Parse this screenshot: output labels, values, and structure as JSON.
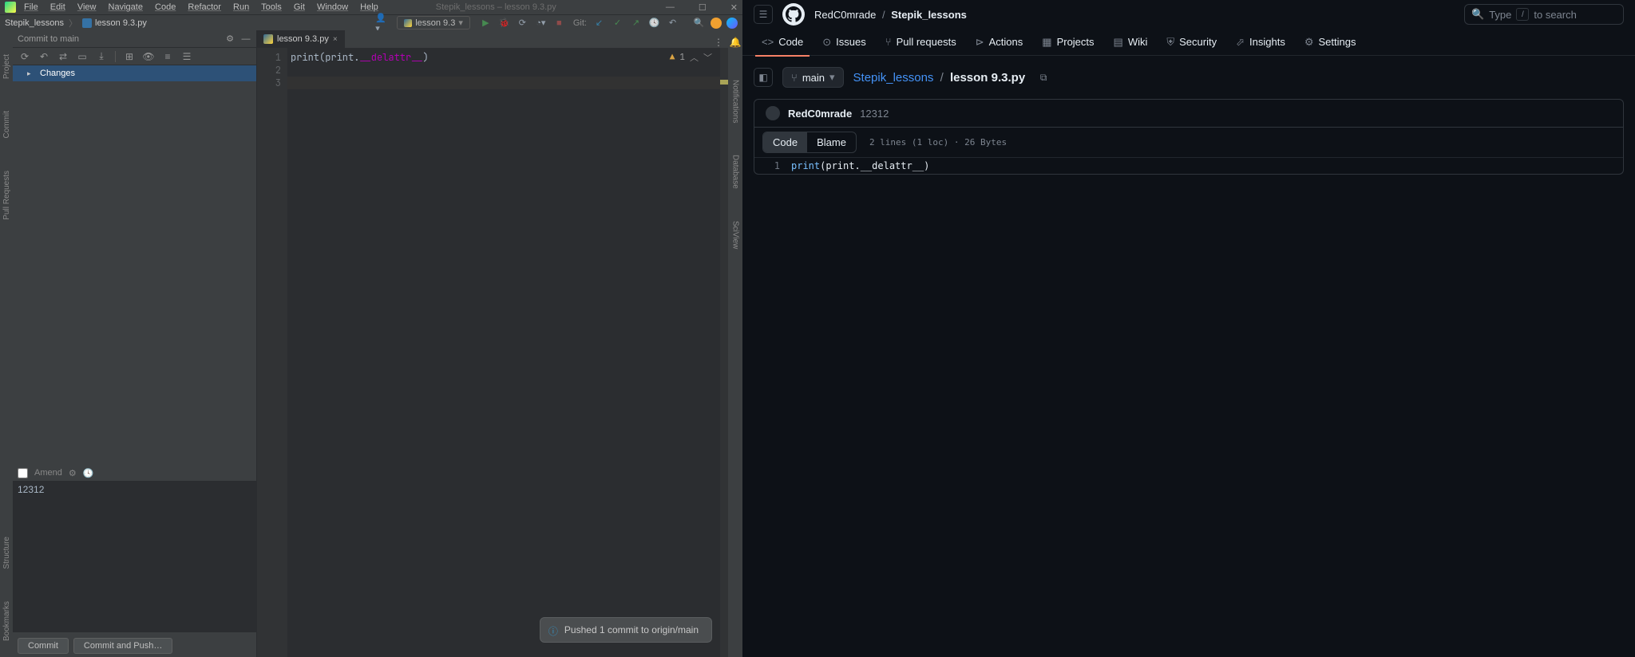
{
  "ide": {
    "menus": [
      "File",
      "Edit",
      "View",
      "Navigate",
      "Code",
      "Refactor",
      "Run",
      "Tools",
      "Git",
      "Window",
      "Help"
    ],
    "title": "Stepik_lessons – lesson 9.3.py",
    "crumbs": {
      "project": "Stepik_lessons",
      "file": "lesson 9.3.py"
    },
    "run_config": "lesson 9.3",
    "git_label": "Git:",
    "tab": "lesson 9.3.py",
    "warning_count": "1",
    "gutter": [
      "1",
      "2",
      "3"
    ],
    "code": {
      "prefix": "print(print.",
      "dunder": "__delattr__",
      "suffix": ")"
    },
    "commit": {
      "title": "Commit to main",
      "changes_label": "Changes",
      "amend_label": "Amend",
      "message": "12312",
      "commit_btn": "Commit",
      "commit_push_btn": "Commit and Push…"
    },
    "vleft": [
      "Project",
      "Commit",
      "Pull Requests"
    ],
    "vleft2": [
      "Structure",
      "Bookmarks"
    ],
    "vright": [
      "Notifications",
      "Database",
      "SciView"
    ],
    "balloon": "Pushed 1 commit to origin/main"
  },
  "gh": {
    "owner": "RedC0mrade",
    "repo": "Stepik_lessons",
    "search_prefix": "Type",
    "search_suffix": "to search",
    "nav": [
      {
        "icon": "<>",
        "label": "Code",
        "active": true
      },
      {
        "icon": "⊙",
        "label": "Issues"
      },
      {
        "icon": "⑂",
        "label": "Pull requests"
      },
      {
        "icon": "⊳",
        "label": "Actions"
      },
      {
        "icon": "▦",
        "label": "Projects"
      },
      {
        "icon": "▤",
        "label": "Wiki"
      },
      {
        "icon": "⛨",
        "label": "Security"
      },
      {
        "icon": "⬀",
        "label": "Insights"
      },
      {
        "icon": "⚙",
        "label": "Settings"
      }
    ],
    "branch": "main",
    "path": {
      "repo": "Stepik_lessons",
      "file": "lesson 9.3.py"
    },
    "commit": {
      "author": "RedC0mrade",
      "message": "12312"
    },
    "code_tab": "Code",
    "blame_tab": "Blame",
    "file_meta": "2 lines (1 loc) · 26 Bytes",
    "code_ln": "1",
    "code_builtin": "print",
    "code_rest": "(print.__delattr__)"
  }
}
